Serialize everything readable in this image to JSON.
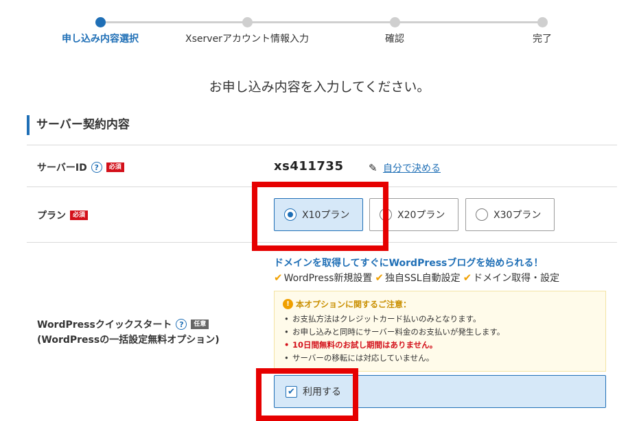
{
  "steps": [
    {
      "label": "申し込み内容選択",
      "active": true
    },
    {
      "label": "Xserverアカウント情報入力",
      "active": false
    },
    {
      "label": "確認",
      "active": false
    },
    {
      "label": "完了",
      "active": false
    }
  ],
  "page_subtitle": "お申し込み内容を入力してください。",
  "section_title": "サーバー契約内容",
  "server_id": {
    "label": "サーバーID",
    "required_badge": "必須",
    "value": "xs411735",
    "decide_link": "自分で決める"
  },
  "plan": {
    "label": "プラン",
    "required_badge": "必須",
    "options": [
      {
        "label": "X10プラン",
        "selected": true
      },
      {
        "label": "X20プラン",
        "selected": false
      },
      {
        "label": "X30プラン",
        "selected": false
      }
    ]
  },
  "wp_quickstart": {
    "label_line1": "WordPressクイックスタート",
    "label_line2": "(WordPressの一括設定無料オプション)",
    "optional_badge": "任意",
    "headline": "ドメインを取得してすぐにWordPressブログを始められる！",
    "features": [
      "WordPress新規設置",
      "独自SSL自動設定",
      "ドメイン取得・設定"
    ],
    "notice_title": "本オプションに関するご注意：",
    "notice_items": [
      "お支払方法はクレジットカード払いのみとなります。",
      "お申し込みと同時にサーバー料金のお支払いが発生します。",
      "10日間無料のお試し期間はありません。",
      "サーバーの移転には対応していません。"
    ],
    "use_label": "利用する",
    "use_checked": true
  },
  "icons": {
    "help": "question-circle-icon",
    "pencil": "pencil-icon",
    "check": "checkmark-icon",
    "warning": "exclamation-circle-icon"
  },
  "colors": {
    "accent": "#1f6fb6",
    "required": "#d3101a",
    "highlight": "#e60000",
    "check": "#f0a000"
  }
}
